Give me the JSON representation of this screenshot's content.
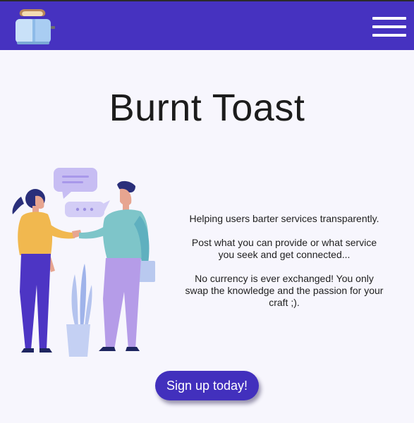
{
  "header": {
    "logo_icon": "toaster-icon",
    "menu_icon": "hamburger-menu-icon",
    "bar_color": "#4632c0"
  },
  "hero": {
    "title": "Burnt Toast",
    "illustration": "people-handshake-illustration",
    "paragraphs": [
      "Helping users barter services transparently.",
      "Post what you can provide or what service you seek and get connected...",
      "No currency is ever exchanged! You only swap the knowledge and the passion for your craft ;)."
    ]
  },
  "cta": {
    "label": "Sign up today!",
    "color": "#4230bd"
  }
}
